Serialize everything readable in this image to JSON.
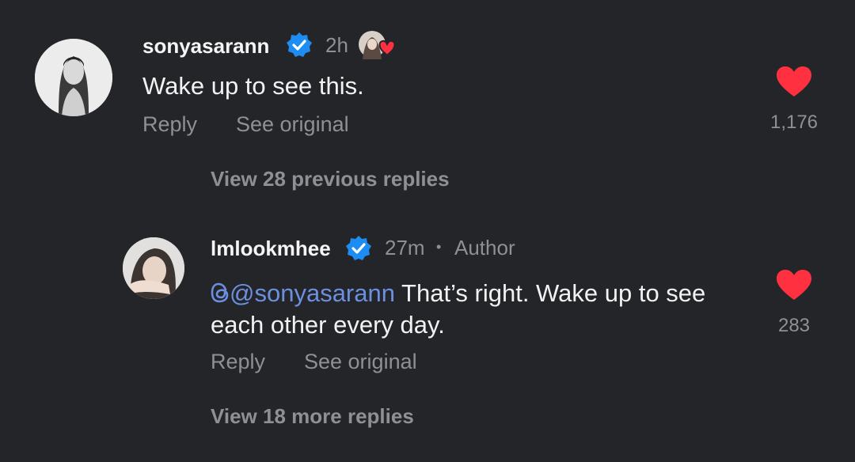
{
  "colors": {
    "background": "#242529",
    "verified_badge": "#1d8cf3",
    "like_heart": "#ff3040",
    "mention": "#6c8fe0",
    "secondary_text": "#8e9096"
  },
  "comment": {
    "username": "sonyasarann",
    "time": "2h",
    "text": "Wake up to see this.",
    "reply_label": "Reply",
    "see_original_label": "See original",
    "like_count": "1,176",
    "view_previous_label": "View 28 previous replies",
    "icons": [
      "verified-badge-icon",
      "liked-by-author-icon",
      "heart-icon"
    ]
  },
  "reply": {
    "username": "lmlookmhee",
    "time": "27m",
    "separator": "•",
    "author_label": "Author",
    "mention": "@sonyasarann",
    "text_line1": "That’s right. Wake up to see",
    "text_line2": "each other every day.",
    "reply_label": "Reply",
    "see_original_label": "See original",
    "like_count": "283",
    "view_more_label": "View 18 more replies",
    "icons": [
      "verified-badge-icon",
      "threads-icon",
      "heart-icon"
    ]
  }
}
